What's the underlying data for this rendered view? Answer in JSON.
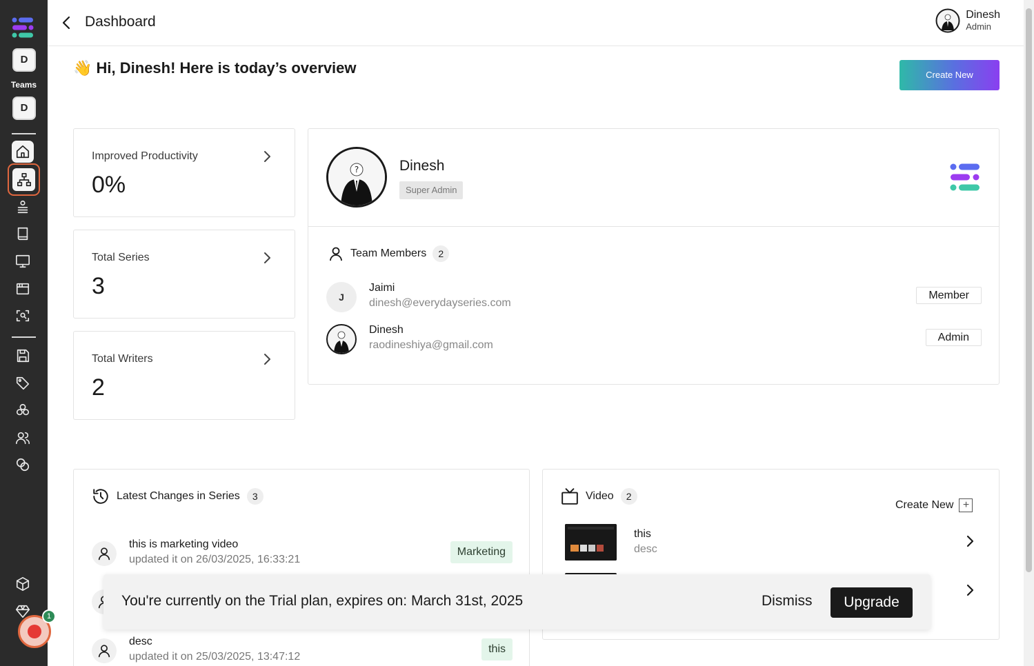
{
  "sidebar": {
    "team_chip_1": "D",
    "teams_label": "Teams",
    "team_chip_2": "D",
    "nav_icons": [
      "home-icon",
      "org-chart-icon",
      "stack-icon",
      "book-icon",
      "monitor-icon",
      "browser-window-icon",
      "scan-face-icon",
      "save-icon",
      "tag-icon",
      "cluster-icon",
      "users-icon",
      "coins-icon",
      "package-icon",
      "gem-icon"
    ],
    "record_badge": "1"
  },
  "header": {
    "title": "Dashboard",
    "user_name": "Dinesh",
    "user_role": "Admin"
  },
  "main": {
    "greeting_emoji": "👋",
    "greeting": "Hi, Dinesh! Here is today’s overview",
    "create_new_label": "Create New"
  },
  "stats": [
    {
      "label": "Improved Productivity",
      "value": "0%"
    },
    {
      "label": "Total Series",
      "value": "3"
    },
    {
      "label": "Total Writers",
      "value": "2"
    }
  ],
  "profile": {
    "name": "Dinesh",
    "role": "Super Admin",
    "team_members_label": "Team Members",
    "team_members_count": "2",
    "members": [
      {
        "initial": "J",
        "name": "Jaimi",
        "email": "dinesh@everydayseries.com",
        "role": "Member"
      },
      {
        "initial": "",
        "name": "Dinesh",
        "email": "raodineshiya@gmail.com",
        "role": "Admin"
      }
    ]
  },
  "series_panel": {
    "title": "Latest Changes in Series",
    "count": "3",
    "items": [
      {
        "title": "this is marketing video",
        "date": "updated it on 26/03/2025, 16:33:21",
        "tag": "Marketing"
      },
      {
        "title": "desc",
        "date": "updated it on 25/03/2025, 13:47:12",
        "tag": "this"
      }
    ]
  },
  "video_panel": {
    "title": "Video",
    "count": "2",
    "create_new_label": "Create New",
    "items": [
      {
        "title": "this",
        "desc": "desc"
      }
    ]
  },
  "banner": {
    "text": "You're currently on the Trial plan, expires on: March 31st, 2025",
    "dismiss_label": "Dismiss",
    "upgrade_label": "Upgrade"
  },
  "colors": {
    "sidebar_bg": "#2b2b2b",
    "accent_orange": "#e0673f",
    "gradient_start": "#2fb9a8",
    "gradient_end": "#8a3ff0",
    "tag_bg": "#e3f5ea"
  }
}
